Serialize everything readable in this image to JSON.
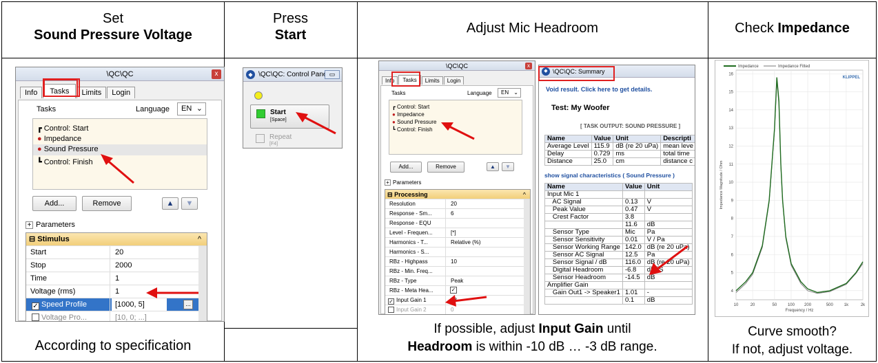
{
  "headers": {
    "col1_line1": "Set",
    "col1_line2": "Sound Pressure Voltage",
    "col2_line1": "Press",
    "col2_line2": "Start",
    "col3": "Adjust Mic Headroom",
    "col4_pre": "Check ",
    "col4_bold": "Impedance"
  },
  "footers": {
    "col1": "According to specification",
    "col3_pre1": "If possible, adjust ",
    "col3_bold1": "Input Gain",
    "col3_post1": " until",
    "col3_bold2": "Headroom",
    "col3_post2": " is within -10 dB … -3 dB range.",
    "col4_line1": "Curve smooth?",
    "col4_line2": "If not, adjust voltage."
  },
  "qc_window": {
    "title": "\\QC\\QC",
    "close": "x",
    "tabs": [
      "Info",
      "Tasks",
      "Limits",
      "Login"
    ],
    "tasks_label": "Tasks",
    "language_label": "Language",
    "language_value": "EN",
    "task_items": [
      "Control: Start",
      "Impedance",
      "Sound Pressure",
      "Control: Finish"
    ],
    "add_button": "Add...",
    "remove_button": "Remove",
    "parameters_label": "Parameters",
    "group": "Stimulus",
    "rows": [
      {
        "k": "Start",
        "v": "20"
      },
      {
        "k": "Stop",
        "v": "2000"
      },
      {
        "k": "Time",
        "v": "1"
      },
      {
        "k": "Voltage (rms)",
        "v": "1"
      },
      {
        "k": "Speed Profile",
        "v": "[1000,  5]"
      },
      {
        "k": "Voltage Pro...",
        "v": "[10,  0; ...]"
      }
    ]
  },
  "control_panel": {
    "title": "\\QC\\QC: Control Panel",
    "start_label": "Start",
    "start_key": "[Space]",
    "repeat_label": "Repeat",
    "repeat_key": "[F4]"
  },
  "qc_window_small": {
    "title": "\\QC\\QC",
    "tabs": [
      "Info",
      "Tasks",
      "Limits",
      "Login"
    ],
    "tasks_label": "Tasks",
    "language_label": "Language",
    "language_value": "EN",
    "task_items": [
      "Control: Start",
      "Impedance",
      "Sound Pressure",
      "Control: Finish"
    ],
    "add_button": "Add...",
    "remove_button": "Remove",
    "parameters_label": "Parameters",
    "group": "Processing",
    "rows": [
      {
        "k": "Resolution",
        "v": "20"
      },
      {
        "k": "Response - Sm...",
        "v": "6"
      },
      {
        "k": "Response - EQU",
        "v": ""
      },
      {
        "k": "Level - Frequen...",
        "v": "[*]"
      },
      {
        "k": "Harmonics - T...",
        "v": "Relative (%)"
      },
      {
        "k": "Harmonics - S...",
        "v": ""
      },
      {
        "k": "RBz - Highpass",
        "v": "10"
      },
      {
        "k": "RBz - Min. Freq...",
        "v": ""
      },
      {
        "k": "RBz - Type",
        "v": "Peak"
      },
      {
        "k": "RBz - Meta Hea...",
        "v": "✓"
      },
      {
        "k": "Input Gain 1",
        "v": "18"
      },
      {
        "k": "Input Gain 2",
        "v": "0"
      }
    ]
  },
  "summary": {
    "title": "\\QC\\QC: Summary",
    "void_link": "Void result. Click here to get details.",
    "test_title": "Test: My Woofer",
    "task_output": "[ TASK OUTPUT: SOUND PRESSURE ]",
    "t1_headers": [
      "Name",
      "Value",
      "Unit",
      "Descripti"
    ],
    "t1_rows": [
      [
        "Average Level",
        "115.9",
        "dB (re 20 uPa)",
        "mean leve"
      ],
      [
        "Delay",
        "0.729",
        "ms",
        "total time"
      ],
      [
        "Distance",
        "25.0",
        "cm",
        "distance c"
      ]
    ],
    "signal_link": "show signal characteristics ( Sound Pressure )",
    "t2_headers": [
      "Name",
      "Value",
      "Unit"
    ],
    "t2_rows": [
      [
        "Input Mic 1",
        "",
        ""
      ],
      [
        "   AC Signal",
        "0.13",
        "V"
      ],
      [
        "   Peak Value",
        "0.47",
        "V"
      ],
      [
        "   Crest Factor",
        "3.8",
        ""
      ],
      [
        "",
        "11.6",
        "dB"
      ],
      [
        "   Sensor Type",
        "Mic",
        "Pa"
      ],
      [
        "   Sensor Sensitivity",
        "0.01",
        "V / Pa"
      ],
      [
        "   Sensor Working Range",
        "142.0",
        "dB (re 20 uPa)"
      ],
      [
        "   Sensor AC Signal",
        "12.5",
        "Pa"
      ],
      [
        "   Sensor Signal / dB",
        "116.0",
        "dB (re 20 uPa)"
      ],
      [
        "   Digital Headroom",
        "-6.8",
        "dBFS"
      ],
      [
        "   Sensor Headroom",
        "-14.5",
        "dB"
      ],
      [
        "Amplifier Gain",
        "",
        ""
      ],
      [
        "   Gain Out1 -> Speaker1",
        "1.01",
        "-"
      ],
      [
        "",
        "0.1",
        "dB"
      ]
    ]
  },
  "chart_data": {
    "type": "line",
    "legend": [
      "Impedance",
      "Impedance Fitted"
    ],
    "brand": "KLIPPEL",
    "xlabel": "Frequency / Hz",
    "ylabel": "Impedance Magnitude / Ohm",
    "x_ticks": [
      "10",
      "20",
      "50",
      "100",
      "200",
      "500",
      "1k",
      "2k"
    ],
    "y_ticks": [
      "4",
      "5",
      "6",
      "7",
      "8",
      "9",
      "10",
      "11",
      "12",
      "13",
      "14",
      "15",
      "16"
    ],
    "x_scale": "log",
    "xlim": [
      10,
      2000
    ],
    "ylim": [
      3.5,
      16.2
    ],
    "series": [
      {
        "name": "Impedance",
        "color": "#1f6b1f",
        "x": [
          10,
          15,
          20,
          30,
          40,
          50,
          55,
          60,
          65,
          70,
          80,
          100,
          150,
          200,
          300,
          500,
          1000,
          1500,
          2000
        ],
        "y": [
          4.0,
          4.5,
          5.0,
          6.5,
          9.0,
          13.0,
          15.8,
          14.5,
          11.0,
          9.0,
          7.0,
          5.5,
          4.5,
          4.1,
          3.9,
          4.0,
          4.4,
          5.0,
          5.6
        ]
      },
      {
        "name": "Impedance Fitted",
        "color": "#777777",
        "x": [
          10,
          15,
          20,
          30,
          40,
          50,
          55,
          60,
          65,
          70,
          80,
          100,
          150,
          200,
          300,
          500,
          1000,
          1500,
          2000
        ],
        "y": [
          3.9,
          4.4,
          4.9,
          6.4,
          8.9,
          12.9,
          15.6,
          14.3,
          10.9,
          8.9,
          6.9,
          5.4,
          4.4,
          4.0,
          3.85,
          3.95,
          4.35,
          4.95,
          5.5
        ]
      }
    ]
  }
}
